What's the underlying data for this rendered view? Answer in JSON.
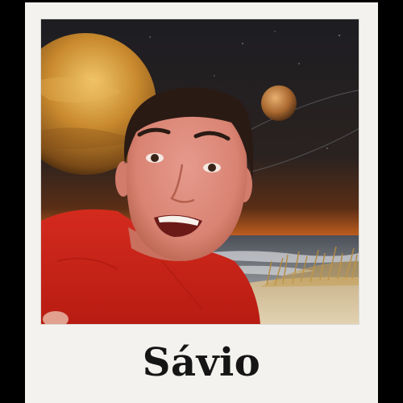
{
  "caption": {
    "name": "Sávio"
  },
  "photo": {
    "shirt_color": "#d42a1e",
    "sky_top_color": "#1d1d22",
    "horizon_color": "#e0802f",
    "planet_color": "#c98a2e"
  }
}
